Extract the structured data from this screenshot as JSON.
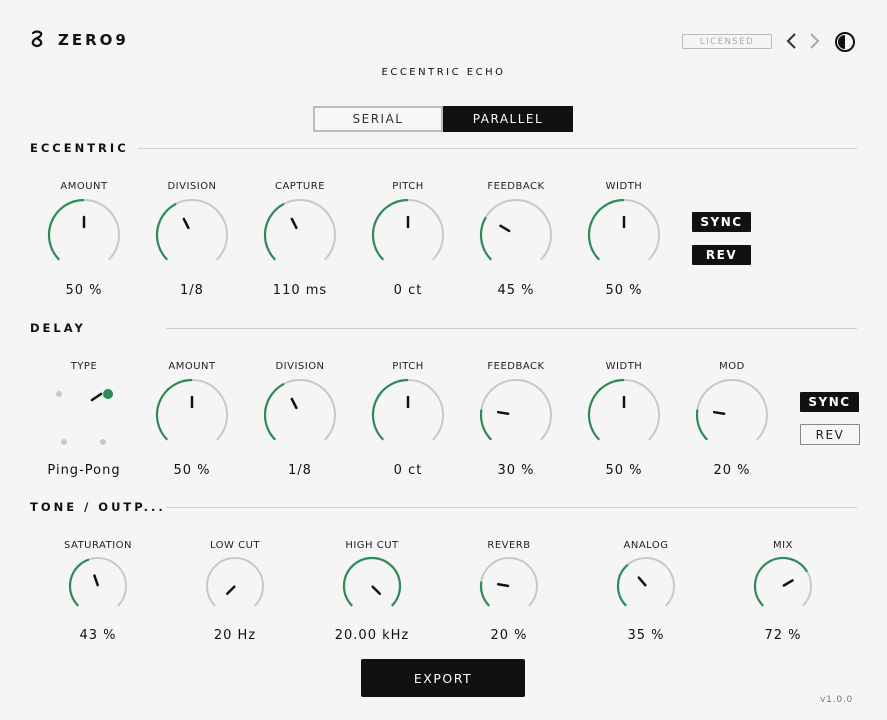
{
  "header": {
    "brand": "ZERO9",
    "plugin_name": "ECCENTRIC ECHO",
    "license_badge": "LICENSED",
    "nav_back_icon": "chevron-left-icon",
    "nav_forward_icon": "chevron-right-icon",
    "theme_icon": "contrast-icon",
    "logo_icon": "zero9-logo-icon"
  },
  "mode": {
    "options": [
      "SERIAL",
      "PARALLEL"
    ],
    "selected": "PARALLEL"
  },
  "sections": {
    "eccentric": "ECCENTRIC",
    "delay": "DELAY",
    "tone": "TONE / OUTP..."
  },
  "eccentric": {
    "knobs": [
      {
        "label": "AMOUNT",
        "value": "50 %",
        "level": 0.5
      },
      {
        "label": "DIVISION",
        "value": "1/8",
        "level": 0.4
      },
      {
        "label": "CAPTURE",
        "value": "110 ms",
        "level": 0.4
      },
      {
        "label": "PITCH",
        "value": "0 ct",
        "level": 0.5
      },
      {
        "label": "FEEDBACK",
        "value": "45 %",
        "level": 0.28
      },
      {
        "label": "WIDTH",
        "value": "50 %",
        "level": 0.5
      }
    ],
    "sync_label": "SYNC",
    "rev_label": "REV",
    "sync_on": true,
    "rev_on": true
  },
  "delay": {
    "type_label": "TYPE",
    "type_value": "Ping-Pong",
    "knobs": [
      {
        "label": "AMOUNT",
        "value": "50 %",
        "level": 0.5
      },
      {
        "label": "DIVISION",
        "value": "1/8",
        "level": 0.4
      },
      {
        "label": "PITCH",
        "value": "0 ct",
        "level": 0.5
      },
      {
        "label": "FEEDBACK",
        "value": "30 %",
        "level": 0.2
      },
      {
        "label": "WIDTH",
        "value": "50 %",
        "level": 0.5
      },
      {
        "label": "MOD",
        "value": "20 %",
        "level": 0.2
      }
    ],
    "sync_label": "SYNC",
    "rev_label": "REV",
    "sync_on": true,
    "rev_on": false
  },
  "tone": {
    "knobs": [
      {
        "label": "SATURATION",
        "value": "43 %",
        "level": 0.43
      },
      {
        "label": "LOW CUT",
        "value": "20 Hz",
        "level": 0.0
      },
      {
        "label": "HIGH CUT",
        "value": "20.00 kHz",
        "level": 1.0
      },
      {
        "label": "REVERB",
        "value": "20 %",
        "level": 0.2
      },
      {
        "label": "ANALOG",
        "value": "35 %",
        "level": 0.35
      },
      {
        "label": "MIX",
        "value": "72 %",
        "level": 0.72
      }
    ]
  },
  "footer": {
    "export_label": "EXPORT",
    "version": "v1.0.0"
  },
  "colors": {
    "accent": "#2e8b57",
    "track": "#c8c8c8",
    "dark": "#111111"
  }
}
